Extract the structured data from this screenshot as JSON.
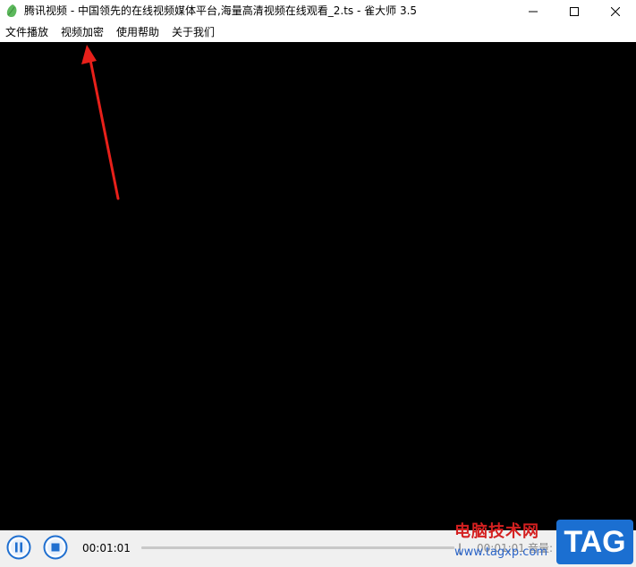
{
  "window": {
    "title": "腾讯视频 - 中国领先的在线视频媒体平台,海量高清视频在线观看_2.ts - 雀大师 3.5",
    "app_icon": "leaf-icon",
    "controls": {
      "minimize_icon": "minimize-icon",
      "maximize_icon": "maximize-icon",
      "close_icon": "close-icon"
    }
  },
  "menu": {
    "items": [
      {
        "label": "文件播放"
      },
      {
        "label": "视频加密"
      },
      {
        "label": "使用帮助"
      },
      {
        "label": "关于我们"
      }
    ]
  },
  "player": {
    "pause_icon": "pause-icon",
    "stop_icon": "stop-icon",
    "current_time": "00:01:01",
    "progress_fraction": 1.0,
    "total_time": "00:01:01",
    "volume_label": "音量:"
  },
  "watermark": {
    "main": "电脑技术网",
    "url": "www.tagxp.com",
    "tag": "TAG"
  },
  "colors": {
    "video_bg": "#000000",
    "control_bg": "#f0f0f0",
    "annotation_arrow": "#e8201a",
    "button_blue": "#1f6fd0",
    "watermark_red": "#d42020",
    "watermark_blue": "#1b6fd1"
  }
}
